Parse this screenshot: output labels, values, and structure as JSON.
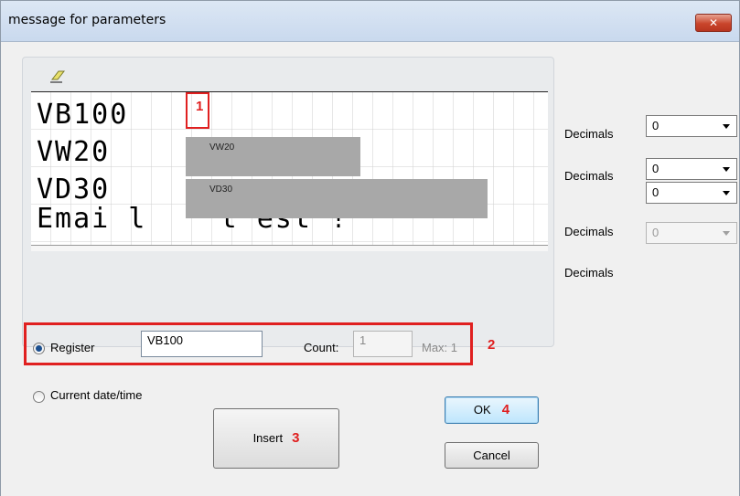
{
  "window": {
    "title": "message for parameters",
    "close_glyph": "✕"
  },
  "editor": {
    "toolbar_icon": "eraser-icon",
    "rows": [
      {
        "text": "VB100"
      },
      {
        "text": "VW20"
      },
      {
        "text": "VD30"
      },
      {
        "text": "Emai l    t est !"
      }
    ],
    "marker_number": "1",
    "fields": [
      {
        "label": "VW20"
      },
      {
        "label": "VD30"
      }
    ]
  },
  "decimals": [
    {
      "label": "Decimals",
      "value": "0",
      "enabled": true
    },
    {
      "label": "Decimals",
      "value": "0",
      "enabled": true
    },
    {
      "label": "Decimals",
      "value": "0",
      "enabled": true
    },
    {
      "label": "Decimals",
      "value": "0",
      "enabled": false
    }
  ],
  "register": {
    "radio_label": "Register",
    "selected": true,
    "value": "VB100",
    "count_label": "Count:",
    "count_value": "1",
    "max_label": "Max: 1",
    "callout_number": "2"
  },
  "datetime": {
    "radio_label": "Current date/time",
    "selected": false
  },
  "buttons": {
    "insert_label": "Insert",
    "insert_number": "3",
    "ok_label": "OK",
    "ok_number": "4",
    "cancel_label": "Cancel"
  },
  "colors": {
    "callout_red": "#e02020",
    "field_gray": "#a8a8a8",
    "title_bar": "#c9d9ee"
  }
}
